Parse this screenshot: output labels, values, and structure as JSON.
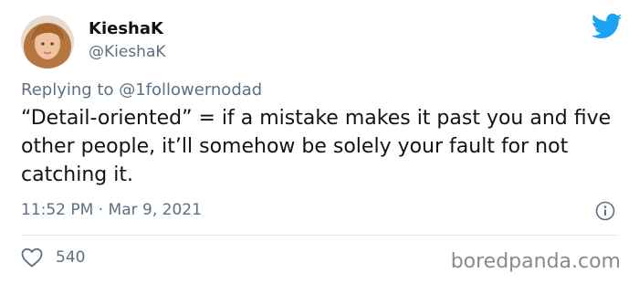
{
  "tweet": {
    "author": {
      "display_name": "KieshaK",
      "handle": "@KieshaK"
    },
    "replying_to": "Replying to @1followernodad",
    "text": "“Detail-oriented” = if a mistake makes it past you and five other people, it’ll somehow be solely your fault for not catching it.",
    "timestamp": "11:52 PM · Mar 9, 2021",
    "like_count": "540"
  },
  "watermark": "boredpanda.com",
  "icons": {
    "brand": "twitter-bird-icon",
    "info": "info-icon",
    "like": "heart-icon"
  },
  "colors": {
    "twitter_blue": "#1da1f2",
    "secondary_text": "#5b7083",
    "primary_text": "#0f1419"
  }
}
